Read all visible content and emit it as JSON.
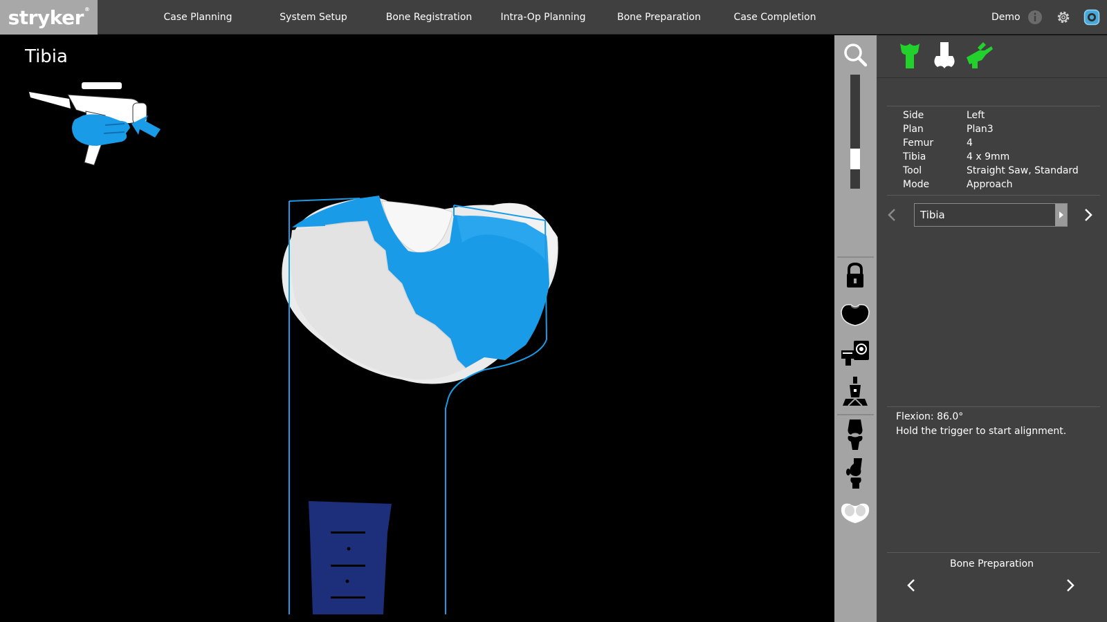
{
  "brand": {
    "logo_text": "stryker",
    "logo_mark": "®"
  },
  "nav": {
    "items": [
      {
        "label": "Case Planning"
      },
      {
        "label": "System Setup"
      },
      {
        "label": "Bone Registration"
      },
      {
        "label": "Intra-Op Planning"
      },
      {
        "label": "Bone Preparation"
      },
      {
        "label": "Case Completion"
      }
    ],
    "user_label": "Demo"
  },
  "viewport": {
    "title": "Tibia",
    "zoom_level": 0.35
  },
  "panel": {
    "info": [
      {
        "key": "Side",
        "value": "Left"
      },
      {
        "key": "Plan",
        "value": "Plan3"
      },
      {
        "key": "Femur",
        "value": "4"
      },
      {
        "key": "Tibia",
        "value": "4 x 9mm"
      },
      {
        "key": "Tool",
        "value": "Straight Saw, Standard"
      },
      {
        "key": "Mode",
        "value": "Approach"
      }
    ],
    "selector_value": "Tibia",
    "status": {
      "flexion": "Flexion: 86.0°",
      "instruction": "Hold the trigger to start alignment."
    },
    "footer_label": "Bone Preparation"
  },
  "colors": {
    "accent_blue": "#1a9be8",
    "active_green": "#22d12c",
    "panel_bg": "#404040",
    "strip_bg": "#a4a4a4",
    "implant_navy": "#1d2f7a"
  },
  "icons": {
    "top": [
      "info-icon",
      "gear-icon",
      "camera-status-icon"
    ],
    "strip": [
      "magnifier-icon",
      "lock-icon",
      "tibia-top-view-icon",
      "camera-tracker-icon",
      "robot-arm-icon",
      "knee-front-icon",
      "knee-side-icon",
      "patella-icon"
    ],
    "panel_head": [
      "femur-tibia-green-icon",
      "bone-white-icon",
      "saw-tool-green-icon"
    ]
  }
}
